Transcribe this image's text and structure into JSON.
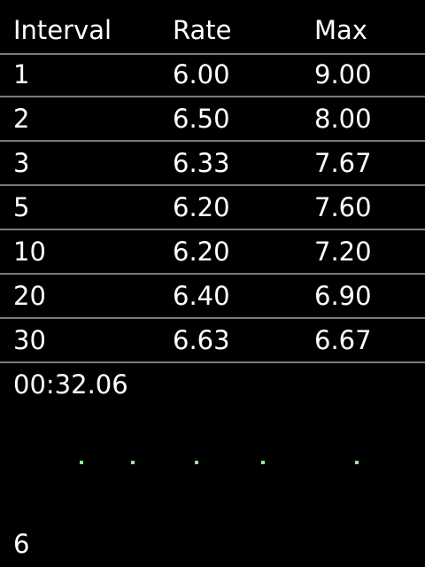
{
  "table": {
    "headers": [
      "Interval",
      "Rate",
      "Max"
    ],
    "rows": [
      [
        "1",
        "6.00",
        "9.00"
      ],
      [
        "2",
        "6.50",
        "8.00"
      ],
      [
        "3",
        "6.33",
        "7.67"
      ],
      [
        "5",
        "6.20",
        "7.60"
      ],
      [
        "10",
        "6.20",
        "7.20"
      ],
      [
        "20",
        "6.40",
        "6.90"
      ],
      [
        "30",
        "6.63",
        "6.67"
      ]
    ]
  },
  "timer": "00:32.06",
  "count": "6",
  "dot_color": "#90ee90"
}
